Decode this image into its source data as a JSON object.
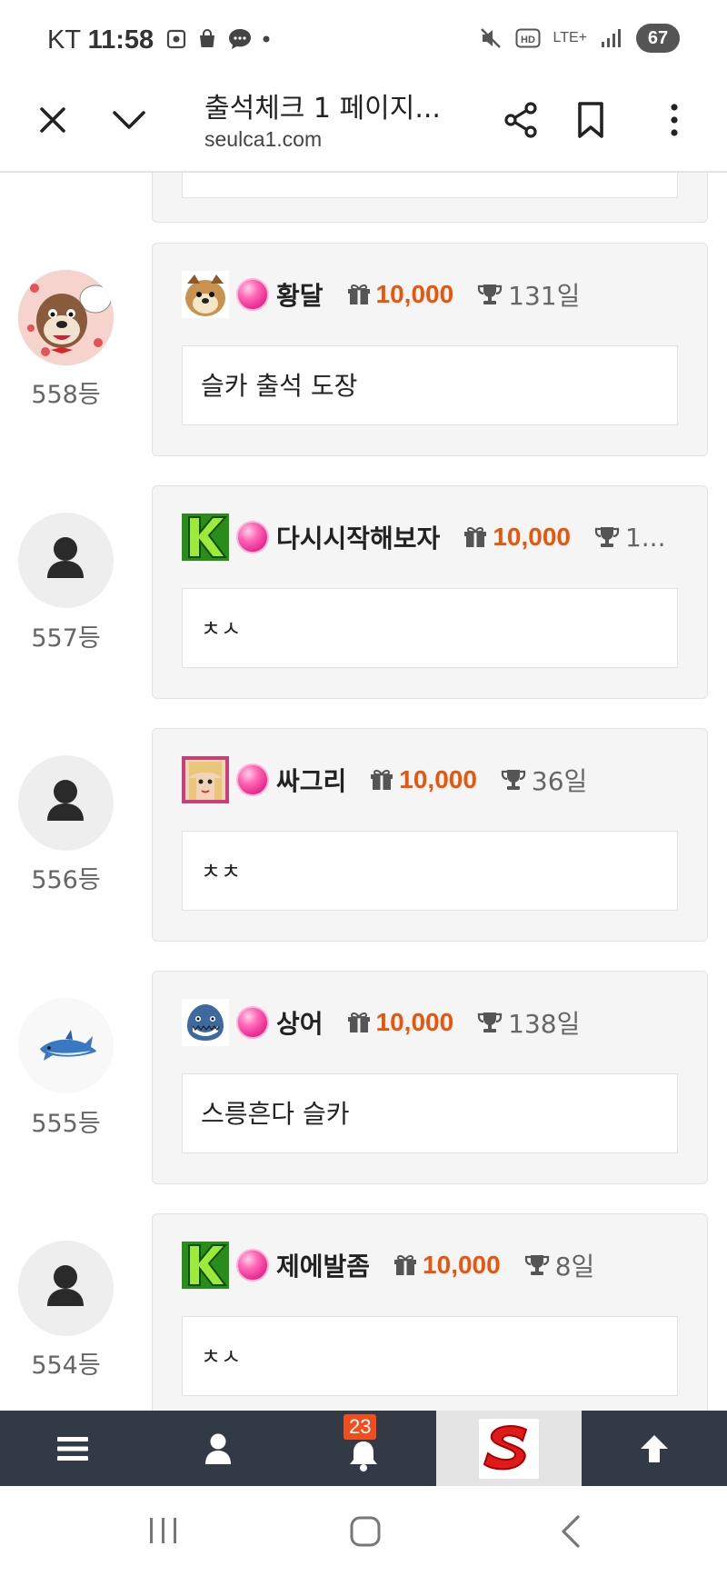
{
  "status_bar": {
    "carrier": "KT",
    "time": "11:58",
    "network": "LTE+",
    "battery": "67"
  },
  "browser": {
    "page_title": "출석체크 1 페이지...",
    "url": "seulca1.com"
  },
  "entries": [
    {
      "rank": "558등",
      "username": "황달",
      "points": "10,000",
      "days": "131일",
      "message": "슬카 출석 도장"
    },
    {
      "rank": "557등",
      "username": "다시시작해보자",
      "points": "10,000",
      "days": "1...",
      "message": "ㅊㅅ"
    },
    {
      "rank": "556등",
      "username": "싸그리",
      "points": "10,000",
      "days": "36일",
      "message": "ㅊㅊ"
    },
    {
      "rank": "555등",
      "username": "상어",
      "points": "10,000",
      "days": "138일",
      "message": "스릉흔다 슬카"
    },
    {
      "rank": "554등",
      "username": "제에발좀",
      "points": "10,000",
      "days": "8일",
      "message": "ㅊㅅ"
    }
  ],
  "site_nav": {
    "notification_count": "23"
  },
  "colors": {
    "points": "#e8550c",
    "site_nav_bg": "#323b45",
    "badge": "#f04e1c"
  }
}
